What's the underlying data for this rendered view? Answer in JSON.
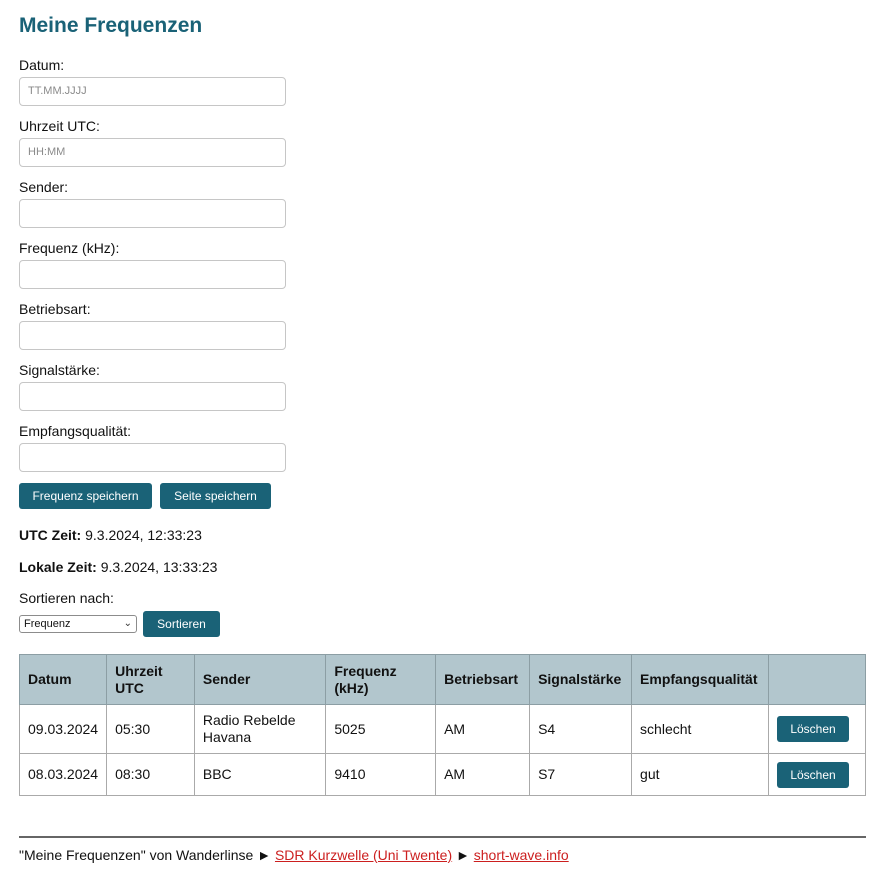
{
  "title": "Meine Frequenzen",
  "form": {
    "fields": [
      {
        "label": "Datum:",
        "value": "",
        "placeholder": "TT.MM.JJJJ"
      },
      {
        "label": "Uhrzeit UTC:",
        "value": "",
        "placeholder": "HH:MM"
      },
      {
        "label": "Sender:",
        "value": "",
        "placeholder": ""
      },
      {
        "label": "Frequenz (kHz):",
        "value": "",
        "placeholder": ""
      },
      {
        "label": "Betriebsart:",
        "value": "",
        "placeholder": ""
      },
      {
        "label": "Signalstärke:",
        "value": "",
        "placeholder": ""
      },
      {
        "label": "Empfangsqualität:",
        "value": "",
        "placeholder": ""
      }
    ],
    "save_button": "Frequenz speichern",
    "save_page_button": "Seite speichern"
  },
  "times": {
    "utc_label": "UTC Zeit:",
    "utc_value": "9.3.2024, 12:33:23",
    "local_label": "Lokale Zeit:",
    "local_value": "9.3.2024, 13:33:23"
  },
  "sort": {
    "label": "Sortieren nach:",
    "selected": "Frequenz",
    "button": "Sortieren"
  },
  "table": {
    "headers": [
      "Datum",
      "Uhrzeit UTC",
      "Sender",
      "Frequenz (kHz)",
      "Betriebsart",
      "Signalstärke",
      "Empfangsqualität",
      ""
    ],
    "rows": [
      {
        "datum": "09.03.2024",
        "uhrzeit": "05:30",
        "sender": "Radio Rebelde Havana",
        "frequenz": "5025",
        "betriebsart": "AM",
        "signal": "S4",
        "qualitaet": "schlecht",
        "action": "Löschen"
      },
      {
        "datum": "08.03.2024",
        "uhrzeit": "08:30",
        "sender": "BBC",
        "frequenz": "9410",
        "betriebsart": "AM",
        "signal": "S7",
        "qualitaet": "gut",
        "action": "Löschen"
      }
    ]
  },
  "footer": {
    "text": "\"Meine Frequenzen\" von Wanderlinse",
    "arrow": "►",
    "link1": "SDR Kurzwelle (Uni Twente)",
    "link2": "short-wave.info"
  },
  "colors": {
    "accent": "#1a6277",
    "table_header": "#b2c6cd",
    "link": "#cc1f1f"
  }
}
